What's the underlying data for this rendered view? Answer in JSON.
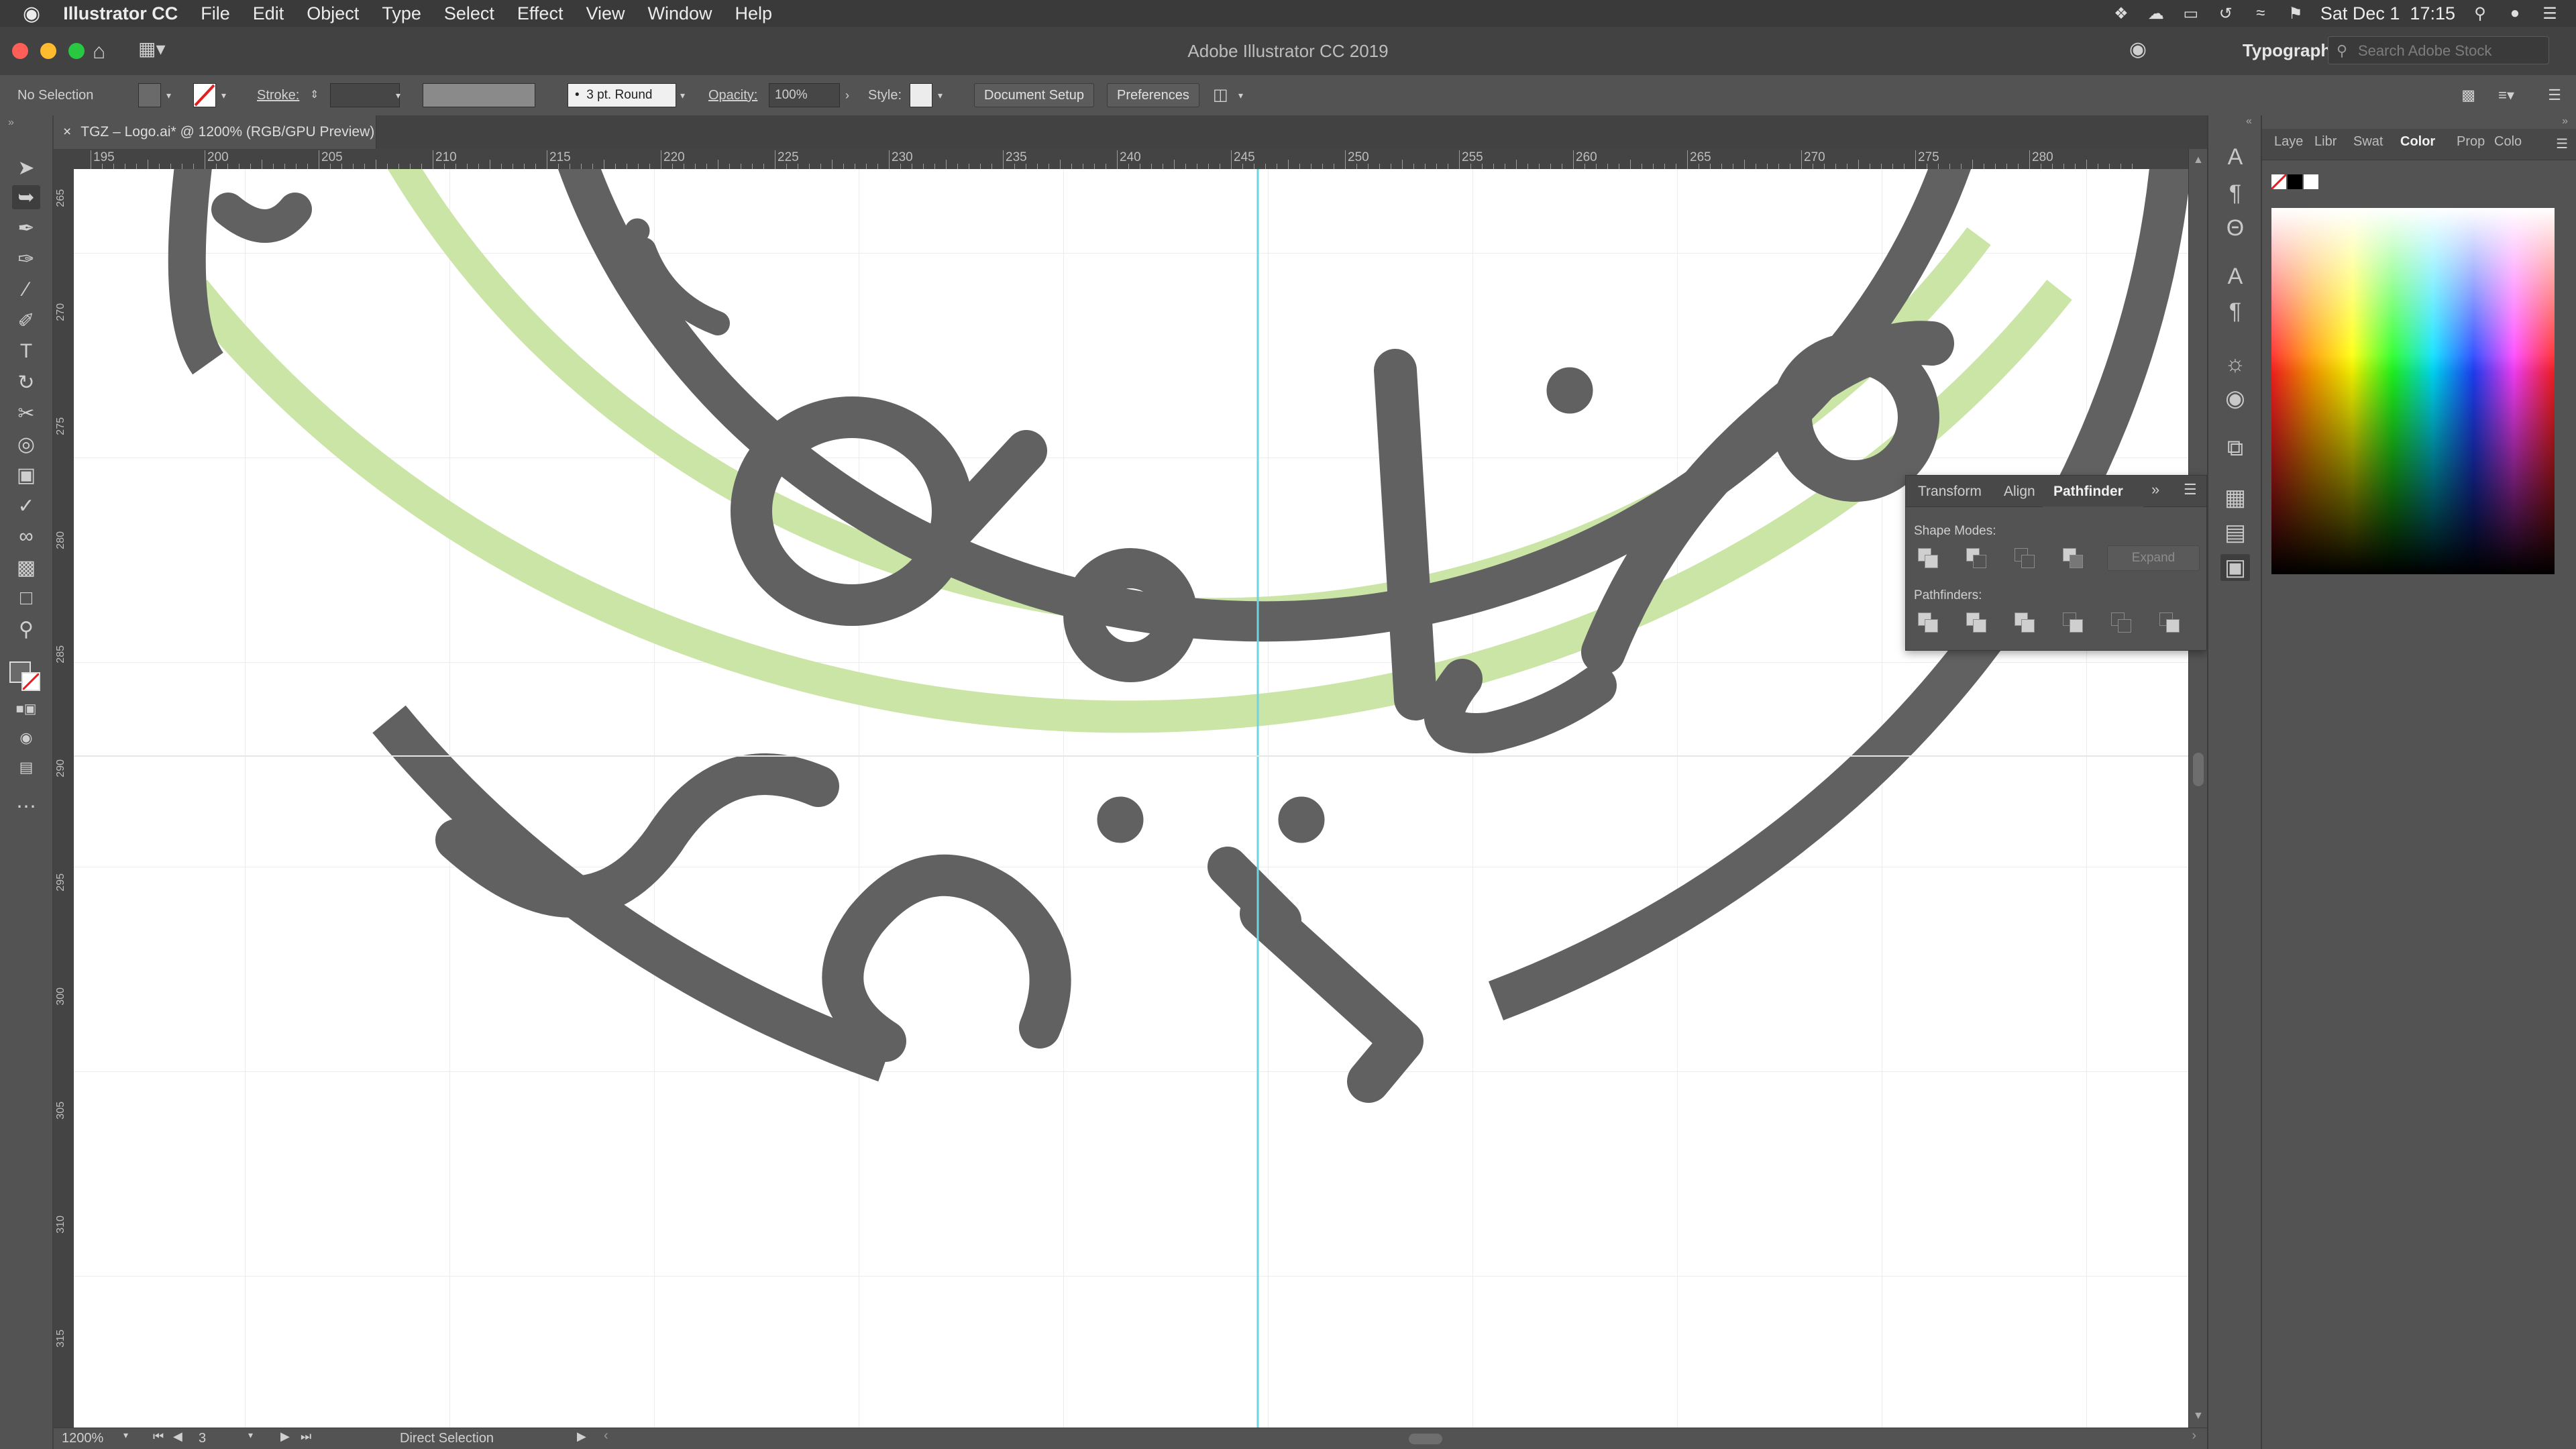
{
  "menubar": {
    "app": "Illustrator CC",
    "items": [
      "File",
      "Edit",
      "Object",
      "Type",
      "Select",
      "Effect",
      "View",
      "Window",
      "Help"
    ],
    "clock": "Sat Dec 1  17:15"
  },
  "window": {
    "title": "Adobe Illustrator CC 2019",
    "workspace": "Typography",
    "search_placeholder": "Search Adobe Stock"
  },
  "control": {
    "selection": "No Selection",
    "stroke_label": "Stroke:",
    "brush": "3 pt. Round",
    "opacity_label": "Opacity:",
    "opacity_value": "100%",
    "style_label": "Style:",
    "doc_setup": "Document Setup",
    "preferences": "Preferences"
  },
  "document": {
    "tab_title": "TGZ – Logo.ai* @ 1200% (RGB/GPU Preview)",
    "close": "×"
  },
  "ruler": {
    "top_labels": [
      "195",
      "200",
      "205",
      "210",
      "215",
      "220",
      "225",
      "230",
      "235",
      "240",
      "245",
      "250",
      "255",
      "260",
      "265",
      "270",
      "275",
      "280"
    ],
    "left_labels": [
      "265",
      "270",
      "275",
      "280",
      "285",
      "290",
      "295",
      "300",
      "305",
      "310",
      "315"
    ]
  },
  "panels": {
    "right_tabs": [
      "Laye",
      "Libr",
      "Swat",
      "Color",
      "Prop",
      "Colo"
    ],
    "pathfinder": {
      "tabs": [
        "Transform",
        "Align",
        "Pathfinder"
      ],
      "shape_modes_label": "Shape Modes:",
      "pathfinders_label": "Pathfinders:",
      "expand": "Expand"
    }
  },
  "status": {
    "zoom": "1200%",
    "artboard": "3",
    "tool": "Direct Selection"
  },
  "colors": {
    "artwork_gray": "#616161",
    "artwork_green": "#cbe5a6",
    "guide_cyan": "#6fd3e0",
    "red_close": "#ff5f57",
    "yellow_min": "#febc2e",
    "green_max": "#28c840"
  }
}
